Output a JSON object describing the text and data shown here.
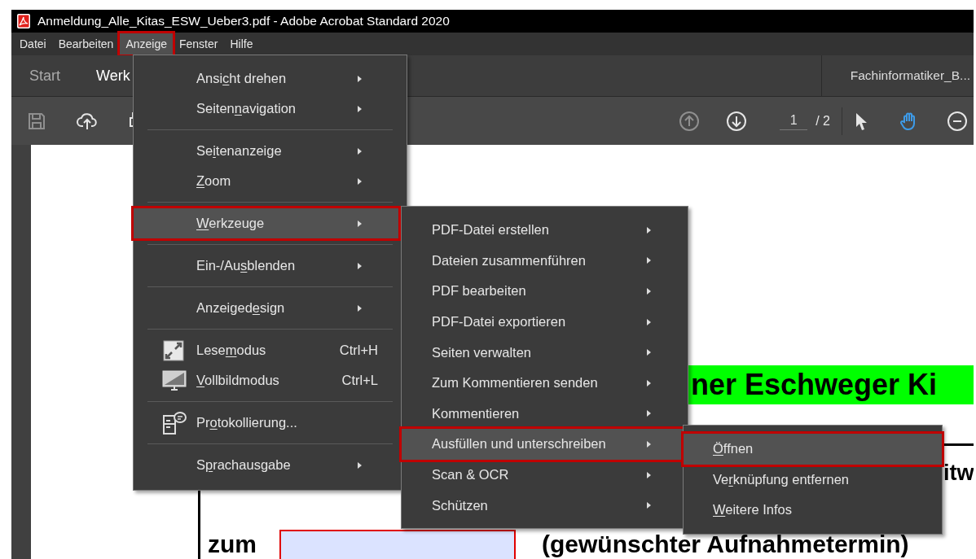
{
  "window": {
    "title": "Anmeldung_Alle_Kitas_ESW_Ueber3.pdf - Adobe Acrobat Standard 2020"
  },
  "menu_bar": [
    {
      "label": "Datei",
      "selected": false,
      "marked": false
    },
    {
      "label": "Bearbeiten",
      "selected": false,
      "marked": false
    },
    {
      "label": "Anzeige",
      "selected": true,
      "marked": true
    },
    {
      "label": "Fenster",
      "selected": false,
      "marked": false
    },
    {
      "label": "Hilfe",
      "selected": false,
      "marked": false
    }
  ],
  "tabs": [
    {
      "label": "Start",
      "selected": false
    },
    {
      "label": "Werk",
      "selected": true
    },
    {
      "label": "Fachinformatiker_B...",
      "selected": false,
      "kind": "document"
    }
  ],
  "toolbar": {
    "left": [
      {
        "kind": "save",
        "disabled": true
      },
      {
        "kind": "upload",
        "disabled": false
      },
      {
        "kind": "print",
        "disabled": false
      }
    ],
    "page": {
      "value": "1",
      "total": "/ 2"
    },
    "nav": [
      {
        "kind": "prev-page",
        "disabled": true
      },
      {
        "kind": "next-page",
        "disabled": false
      }
    ],
    "tools": [
      {
        "kind": "pointer",
        "selected": false
      },
      {
        "kind": "hand",
        "selected": true
      },
      {
        "kind": "zoom-out",
        "selected": false
      }
    ]
  },
  "view_menu": {
    "groups": [
      [
        {
          "before": "Ansi",
          "key": "c",
          "after": "ht drehen",
          "submenu": true,
          "selected": false,
          "marked": false
        },
        {
          "before": "Seiten",
          "key": "n",
          "after": "avigation",
          "submenu": true,
          "selected": false,
          "marked": false
        }
      ],
      [
        {
          "before": "Se",
          "key": "i",
          "after": "tenanzeige",
          "submenu": true,
          "selected": false,
          "marked": false
        },
        {
          "key": "Z",
          "after": "oom",
          "submenu": true,
          "selected": false,
          "marked": false
        }
      ],
      [
        {
          "key": "W",
          "after": "erkzeuge",
          "submenu": true,
          "selected": true,
          "marked": true
        }
      ],
      [
        {
          "before": "Ein-/Au",
          "key": "s",
          "after": "blenden",
          "submenu": true,
          "selected": false,
          "marked": false
        }
      ],
      [
        {
          "before": "Anzeiged",
          "key": "e",
          "after": "sign",
          "submenu": true,
          "selected": false,
          "marked": false
        }
      ],
      [
        {
          "before": "Lese",
          "key": "m",
          "after": "odus",
          "kind": "reading",
          "shortcut": "Ctrl+H",
          "selected": false,
          "marked": false
        },
        {
          "key": "V",
          "after": "ollbildmodus",
          "kind": "fullscreen",
          "shortcut": "Ctrl+L",
          "selected": false,
          "marked": false
        }
      ],
      [
        {
          "before": "Pr",
          "key": "o",
          "after": "tokollierung...",
          "kind": "logging",
          "selected": false,
          "marked": false
        }
      ],
      [
        {
          "before": "S",
          "key": "p",
          "after": "rachausgabe",
          "submenu": true,
          "selected": false,
          "marked": false
        }
      ]
    ]
  },
  "tools_menu": {
    "items": [
      {
        "label": "PDF-Datei erstellen",
        "submenu": true,
        "selected": false,
        "marked": false
      },
      {
        "label": "Dateien zusammenführen",
        "submenu": true,
        "selected": false,
        "marked": false
      },
      {
        "label": "PDF bearbeiten",
        "submenu": true,
        "selected": false,
        "marked": false
      },
      {
        "label": "PDF-Datei exportieren",
        "submenu": true,
        "selected": false,
        "marked": false
      },
      {
        "label": "Seiten verwalten",
        "submenu": true,
        "selected": false,
        "marked": false
      },
      {
        "label": "Zum Kommentieren senden",
        "submenu": true,
        "selected": false,
        "marked": false
      },
      {
        "label": "Kommentieren",
        "submenu": true,
        "selected": false,
        "marked": false
      },
      {
        "label": "Ausfüllen und unterschreiben",
        "submenu": true,
        "selected": true,
        "marked": true
      },
      {
        "label": "Scan & OCR",
        "submenu": true,
        "selected": false,
        "marked": false
      },
      {
        "label": "Schützen",
        "submenu": true,
        "selected": false,
        "marked": false
      }
    ]
  },
  "fill_sign_menu": {
    "items": [
      {
        "key": "Ö",
        "after": "ffnen",
        "selected": true,
        "marked": true
      },
      {
        "before": "Ve",
        "key": "r",
        "after": "knüpfung entfernen",
        "selected": false,
        "marked": false
      },
      {
        "key": "W",
        "after": "eitere Infos",
        "selected": false,
        "marked": false
      }
    ]
  },
  "document": {
    "heading": "ner Eschweger Ki",
    "line_end": "itw",
    "field_label": "zum",
    "field_hint": "(gewünschter Aufnahmetermin)"
  }
}
